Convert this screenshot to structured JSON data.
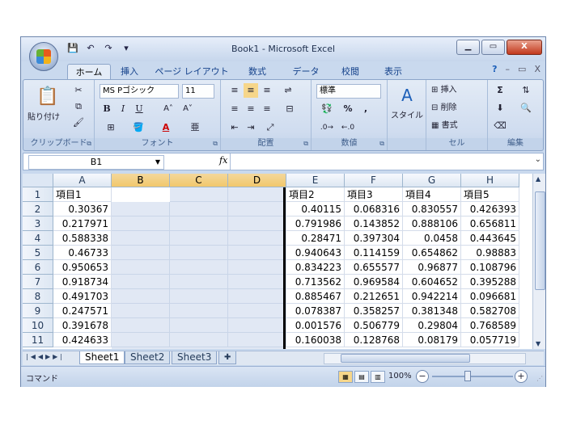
{
  "window": {
    "title": "Book1 - Microsoft Excel",
    "controls": {
      "minimize": "▁",
      "restore": "▭",
      "close": "X"
    }
  },
  "qat": {
    "save_icon": "save-icon",
    "undo_icon": "undo-icon",
    "redo_icon": "redo-icon",
    "customize_icon": "dropdown-icon"
  },
  "ribbon_tabs": [
    "ホーム",
    "挿入",
    "ページ レイアウト",
    "数式",
    "データ",
    "校閲",
    "表示"
  ],
  "ribbon_tab_right": {
    "help": "?",
    "min": "–",
    "restore": "▭",
    "close": "X"
  },
  "ribbon": {
    "clipboard": {
      "label": "クリップボード",
      "paste": "貼り付け"
    },
    "font": {
      "label": "フォント",
      "name": "MS Pゴシック",
      "size": "11",
      "bold": "B",
      "italic": "I",
      "underline": "U",
      "grow": "A˄",
      "shrink": "A˅"
    },
    "alignment": {
      "label": "配置"
    },
    "number": {
      "label": "数値",
      "format": "標準",
      "percent": "%",
      "comma": ","
    },
    "styles": {
      "label": "スタイル"
    },
    "cells": {
      "label": "セル",
      "insert": "挿入",
      "delete": "削除",
      "format": "書式"
    },
    "editing": {
      "label": "編集",
      "sum": "Σ"
    }
  },
  "formula_bar": {
    "name_box": "B1",
    "fx": "fx",
    "formula": ""
  },
  "columns": [
    "A",
    "B",
    "C",
    "D",
    "E",
    "F",
    "G",
    "H"
  ],
  "rows": [
    {
      "num": "1",
      "A": "項目1",
      "E": "項目2",
      "F": "項目3",
      "G": "項目4",
      "H": "項目5"
    },
    {
      "num": "2",
      "A": "0.30367",
      "E": "0.40115",
      "F": "0.068316",
      "G": "0.830557",
      "H": "0.426393"
    },
    {
      "num": "3",
      "A": "0.217971",
      "E": "0.791986",
      "F": "0.143852",
      "G": "0.888106",
      "H": "0.656811"
    },
    {
      "num": "4",
      "A": "0.588338",
      "E": "0.28471",
      "F": "0.397304",
      "G": "0.0458",
      "H": "0.443645"
    },
    {
      "num": "5",
      "A": "0.46733",
      "E": "0.940643",
      "F": "0.114159",
      "G": "0.654862",
      "H": "0.98883"
    },
    {
      "num": "6",
      "A": "0.950653",
      "E": "0.834223",
      "F": "0.655577",
      "G": "0.96877",
      "H": "0.108796"
    },
    {
      "num": "7",
      "A": "0.918734",
      "E": "0.713562",
      "F": "0.969584",
      "G": "0.604652",
      "H": "0.395288"
    },
    {
      "num": "8",
      "A": "0.491703",
      "E": "0.885467",
      "F": "0.212651",
      "G": "0.942214",
      "H": "0.096681"
    },
    {
      "num": "9",
      "A": "0.247571",
      "E": "0.078387",
      "F": "0.358257",
      "G": "0.381348",
      "H": "0.582708"
    },
    {
      "num": "10",
      "A": "0.391678",
      "E": "0.001576",
      "F": "0.506779",
      "G": "0.29804",
      "H": "0.768589"
    },
    {
      "num": "11",
      "A": "0.424633",
      "E": "0.160038",
      "F": "0.128768",
      "G": "0.08179",
      "H": "0.057719"
    }
  ],
  "sheets": [
    "Sheet1",
    "Sheet2",
    "Sheet3"
  ],
  "status": {
    "mode": "コマンド",
    "zoom": "100%"
  }
}
